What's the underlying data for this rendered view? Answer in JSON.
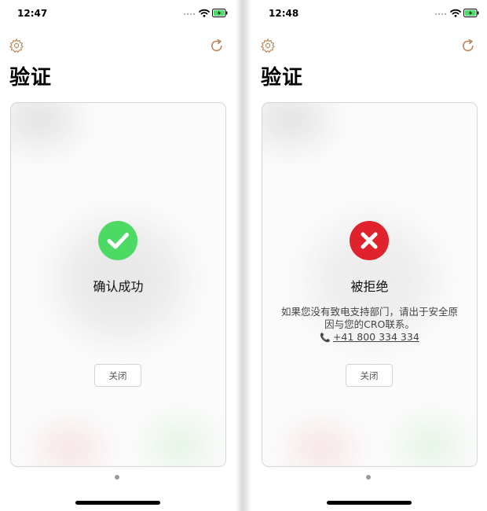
{
  "colors": {
    "accent_icon": "#b9875d",
    "success": "#4cd964",
    "error": "#e0222d",
    "battery": "#4cd964"
  },
  "screens": [
    {
      "status_bar": {
        "time": "12:47"
      },
      "nav": {
        "settings_icon": "gear-icon",
        "reload_icon": "reload-icon"
      },
      "title": "验证",
      "card": {
        "state": "success",
        "icon": "checkmark-icon",
        "status_title": "确认成功",
        "close_label": "关闭"
      }
    },
    {
      "status_bar": {
        "time": "12:48"
      },
      "nav": {
        "settings_icon": "gear-icon",
        "reload_icon": "reload-icon"
      },
      "title": "验证",
      "card": {
        "state": "rejected",
        "icon": "cross-icon",
        "status_title": "被拒绝",
        "message": "如果您没有致电支持部门，请出于安全原因与您的CRO联系。",
        "phone_number": "+41 800 334 334",
        "close_label": "关闭"
      }
    }
  ]
}
